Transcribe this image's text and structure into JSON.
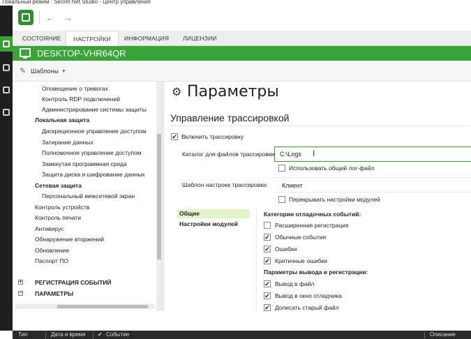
{
  "window": {
    "title": "Локальный режим : Secret Net Studio - Центр управления"
  },
  "toolbar": {
    "back_glyph": "←",
    "forward_glyph": "→"
  },
  "tabs": [
    {
      "label": "СОСТОЯНИЕ",
      "active": false
    },
    {
      "label": "НАСТРОЙКИ",
      "active": true
    },
    {
      "label": "ИНФОРМАЦИЯ",
      "active": false
    },
    {
      "label": "ЛИЦЕНЗИИ",
      "active": false
    }
  ],
  "computer": {
    "name": "DESKTOP-VHR64QR"
  },
  "templates": {
    "label": "Шаблоны"
  },
  "tree": {
    "items": [
      {
        "label": "Оповещение о тревогах"
      },
      {
        "label": "Контроль RDP подключений"
      },
      {
        "label": "Администрирование системы защиты"
      },
      {
        "label": "Локальная защита"
      },
      {
        "label": "Дискреционное управление доступом"
      },
      {
        "label": "Затирание данных"
      },
      {
        "label": "Полномочное управление доступом"
      },
      {
        "label": "Замкнутая программная среда"
      },
      {
        "label": "Защита диска и шифрование данных"
      },
      {
        "label": "Сетевая защита"
      },
      {
        "label": "Персональный межсетевой экран"
      },
      {
        "label": "Контроль устройств"
      },
      {
        "label": "Контроль печати"
      },
      {
        "label": "Антивирус"
      },
      {
        "label": "Обнаружение вторжений"
      },
      {
        "label": "Обновление"
      },
      {
        "label": "Паспорт ПО"
      }
    ],
    "groups": [
      {
        "label": "РЕГИСТРАЦИЯ СОБЫТИЙ",
        "expander": "+"
      },
      {
        "label": "ПАРАМЕТРЫ",
        "expander": "−"
      }
    ]
  },
  "content": {
    "title": "Параметры",
    "section": "Управление трассировкой",
    "enable_tracing": {
      "label": "Включить трассировку",
      "checked": true
    },
    "catalog": {
      "label": "Каталог для файлов трассировки:",
      "value": "C:\\Logs"
    },
    "use_common_log": {
      "label": "Использовать общий лог-файл",
      "checked": false
    },
    "template": {
      "label": "Шаблон настроек трассировки:",
      "value": "Клиент"
    },
    "override_modules": {
      "label": "Перекрывать настройки модулей",
      "checked": false
    },
    "subnav": [
      {
        "label": "Общие",
        "active": true
      },
      {
        "label": "Настройки модулей",
        "active": false
      }
    ],
    "debug_categories": {
      "header": "Категории отладочных событий:",
      "items": [
        {
          "label": "Расширенная регистрация",
          "checked": false
        },
        {
          "label": "Обычные события",
          "checked": true
        },
        {
          "label": "Ошибки",
          "checked": true
        },
        {
          "label": "Критичные ошибки",
          "checked": true
        }
      ]
    },
    "output_params": {
      "header": "Параметры вывода и регистрации:",
      "items": [
        {
          "label": "Вывод в файл",
          "checked": true
        },
        {
          "label": "Вывод в окно отладчика",
          "checked": true
        },
        {
          "label": "Дописать старый файл",
          "checked": true
        }
      ]
    }
  },
  "events_bar": {
    "columns": [
      "Тип",
      "Дата и время",
      "Событие",
      "Описание"
    ]
  }
}
